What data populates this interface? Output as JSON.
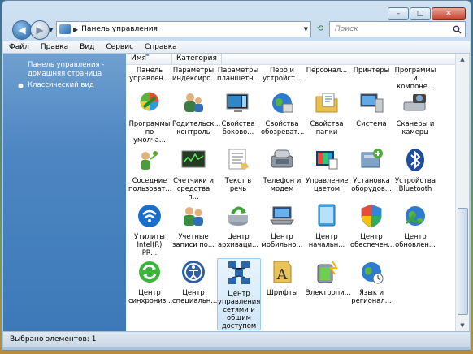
{
  "address": {
    "path": "Панель управления"
  },
  "search": {
    "placeholder": "Поиск"
  },
  "menu": [
    "Файл",
    "Правка",
    "Вид",
    "Сервис",
    "Справка"
  ],
  "left_pane": {
    "home_link": "Панель управления -\nдомашняя страница",
    "classic_view": "Классический вид"
  },
  "columns": {
    "name": "Имя",
    "category": "Категория"
  },
  "items_row0": [
    {
      "label": "Панель\nуправлен...",
      "icon": "control-panel-icon"
    },
    {
      "label": "Параметры\nиндексиро...",
      "icon": "indexing-options-icon"
    },
    {
      "label": "Параметры\nпланшетн...",
      "icon": "tablet-pc-settings-icon"
    },
    {
      "label": "Перо и\nустройст...",
      "icon": "pen-input-icon"
    },
    {
      "label": "Персонал...",
      "icon": "personalization-icon"
    },
    {
      "label": "Принтеры",
      "icon": "printers-icon"
    },
    {
      "label": "Программы\nи компоне...",
      "icon": "programs-features-icon"
    }
  ],
  "items": [
    {
      "label": "Программы\nпо умолча...",
      "icon": "default-programs-icon"
    },
    {
      "label": "Родительск...\nконтроль",
      "icon": "parental-controls-icon"
    },
    {
      "label": "Свойства\nбоково...",
      "icon": "sidebar-properties-icon"
    },
    {
      "label": "Свойства\nобозреват...",
      "icon": "internet-options-icon"
    },
    {
      "label": "Свойства\nпапки",
      "icon": "folder-options-icon"
    },
    {
      "label": "Система",
      "icon": "system-icon"
    },
    {
      "label": "Сканеры и\nкамеры",
      "icon": "scanners-cameras-icon"
    },
    {
      "label": "Соседние\nпользоват...",
      "icon": "people-near-me-icon"
    },
    {
      "label": "Счетчики и\nсредства п...",
      "icon": "performance-counters-icon"
    },
    {
      "label": "Текст в речь",
      "icon": "text-to-speech-icon"
    },
    {
      "label": "Телефон и\nмодем",
      "icon": "phone-modem-icon"
    },
    {
      "label": "Управление\nцветом",
      "icon": "color-management-icon"
    },
    {
      "label": "Установка\nоборудов...",
      "icon": "add-hardware-icon"
    },
    {
      "label": "Устройства\nBluetooth",
      "icon": "bluetooth-icon"
    },
    {
      "label": "Утилиты\nIntel(R) PR...",
      "icon": "intel-wireless-icon"
    },
    {
      "label": "Учетные\nзаписи по...",
      "icon": "user-accounts-icon"
    },
    {
      "label": "Центр\nархиваци...",
      "icon": "backup-center-icon"
    },
    {
      "label": "Центр\nмобильно...",
      "icon": "mobility-center-icon"
    },
    {
      "label": "Центр\nначальн...",
      "icon": "welcome-center-icon"
    },
    {
      "label": "Центр\nобеспечен...",
      "icon": "security-center-icon"
    },
    {
      "label": "Центр\nобновлен...",
      "icon": "windows-update-icon"
    },
    {
      "label": "Центр\nсинхрониз...",
      "icon": "sync-center-icon"
    },
    {
      "label": "Центр\nспециальн...",
      "icon": "ease-of-access-icon"
    },
    {
      "label": "Центр\nуправления\nсетями и\nобщим\nдоступом",
      "icon": "network-sharing-center-icon",
      "selected": true
    },
    {
      "label": "Шрифты",
      "icon": "fonts-icon"
    },
    {
      "label": "Электропи...",
      "icon": "power-options-icon"
    },
    {
      "label": "Язык и\nрегионал...",
      "icon": "regional-language-icon"
    }
  ],
  "status": {
    "text": "Выбрано элементов: 1"
  },
  "colors": {
    "selection": "#cfe6f9",
    "left_pane": "#4d86c2"
  }
}
